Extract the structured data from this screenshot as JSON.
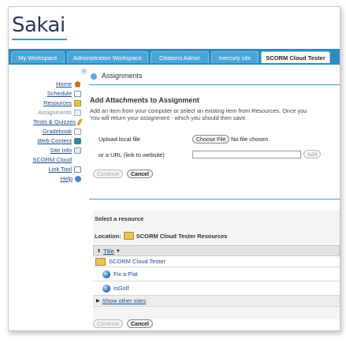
{
  "app": {
    "logo": "Sakai"
  },
  "tabs": [
    {
      "label": "My Workspace",
      "active": false
    },
    {
      "label": "Administration Workspace",
      "active": false
    },
    {
      "label": "Citations Admin",
      "active": false
    },
    {
      "label": "mercury site",
      "active": false
    },
    {
      "label": "SCORM Cloud Tester",
      "active": true
    }
  ],
  "sidebar": {
    "collapse_icon": "collapse-icon",
    "items": [
      {
        "label": "Home",
        "icon": "home-icon",
        "color": "#c46a1c",
        "current": false
      },
      {
        "label": "Schedule",
        "icon": "calendar-icon",
        "color": "#6f8fb5",
        "current": false
      },
      {
        "label": "Resources",
        "icon": "folder-icon",
        "color": "#e8c35a",
        "current": false
      },
      {
        "label": "Assignments",
        "icon": "assignment-icon",
        "color": "#9fb3c9",
        "current": true
      },
      {
        "label": "Tests & Quizzes",
        "icon": "pencil-icon",
        "color": "#e2a12f",
        "current": false
      },
      {
        "label": "Gradebook",
        "icon": "gradebook-icon",
        "color": "#8a9ab0",
        "current": false
      },
      {
        "label": "Web Content",
        "icon": "web-icon",
        "color": "#3a7f9e",
        "current": false
      },
      {
        "label": "Site Info",
        "icon": "site-info-icon",
        "color": "#7a9cc4",
        "current": false
      },
      {
        "label": "SCORM Cloud",
        "icon": "",
        "color": "",
        "current": false
      },
      {
        "label": "Link Tool",
        "icon": "link-icon",
        "color": "#5b8fc7",
        "current": false
      },
      {
        "label": "Help",
        "icon": "help-icon",
        "color": "#4c86c6",
        "current": false
      }
    ]
  },
  "tool": {
    "title": "Assignments",
    "icon": "assignments-tool-icon"
  },
  "main": {
    "heading": "Add Attachments to Assignment",
    "instructions_1": "Add an item from your computer or select an existing item from Resources. Once you",
    "instructions_2": "You will return your assignment - which you should then save.",
    "upload_label": "Upload local file",
    "choose_file_button": "Choose File",
    "no_file_text": "No file chosen",
    "url_label": "or a URL (link to website)",
    "url_value": "",
    "add_button": "Add",
    "continue_button": "Continue",
    "cancel_button": "Cancel"
  },
  "resources": {
    "title": "Select a resource",
    "location_label": "Location:",
    "location_value": "SCORM Cloud Tester Resources",
    "column_title": "Title",
    "rows": [
      {
        "label": "SCORM Cloud Tester",
        "icon": "folder-open-icon"
      },
      {
        "label": "Fix a Flat",
        "icon": "scorm-package-icon"
      },
      {
        "label": "IsGolf",
        "icon": "scorm-package-icon"
      }
    ],
    "show_other_sites": "Show other sites"
  },
  "footer": {
    "continue_button": "Continue",
    "cancel_button": "Cancel"
  }
}
